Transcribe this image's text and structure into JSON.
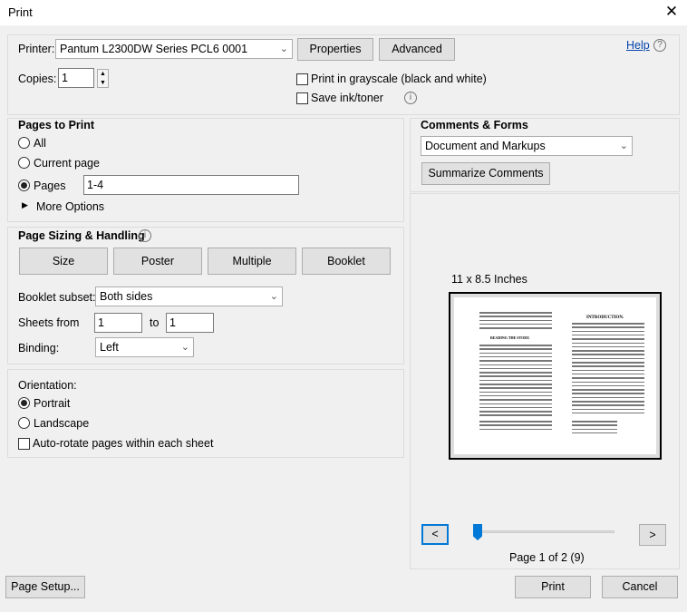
{
  "window": {
    "title": "Print"
  },
  "printer": {
    "label": "Printer:",
    "value": "Pantum L2300DW Series PCL6 0001",
    "properties": "Properties",
    "advanced": "Advanced",
    "help": "Help"
  },
  "copies": {
    "label": "Copies:",
    "value": "1"
  },
  "options": {
    "grayscale": "Print in grayscale (black and white)",
    "save_ink": "Save ink/toner"
  },
  "pages_to_print": {
    "title": "Pages to Print",
    "all": "All",
    "current": "Current page",
    "pages": "Pages",
    "pages_value": "1-4",
    "more": "More Options",
    "selected": "Pages"
  },
  "comments": {
    "title": "Comments & Forms",
    "value": "Document and Markups",
    "summarize": "Summarize Comments"
  },
  "sizing": {
    "title": "Page Sizing & Handling",
    "tabs": [
      "Size",
      "Poster",
      "Multiple",
      "Booklet"
    ],
    "subset_label": "Booklet subset:",
    "subset_value": "Both sides",
    "sheets_label": "Sheets from",
    "sheets_from": "1",
    "to_label": "to",
    "sheets_to": "1",
    "binding_label": "Binding:",
    "binding_value": "Left"
  },
  "orientation": {
    "title": "Orientation:",
    "portrait": "Portrait",
    "landscape": "Landscape",
    "auto_rotate": "Auto-rotate pages within each sheet",
    "selected": "Portrait"
  },
  "preview": {
    "size": "11 x 8.5 Inches",
    "left_heading": "READING THE STORY.",
    "right_heading": "INTRODUCTION.",
    "prev": "<",
    "next": ">",
    "page_status": "Page 1 of 2 (9)",
    "slider_fraction": 0
  },
  "footer": {
    "page_setup": "Page Setup...",
    "print": "Print",
    "cancel": "Cancel"
  },
  "colors": {
    "accent": "#0078d7"
  }
}
